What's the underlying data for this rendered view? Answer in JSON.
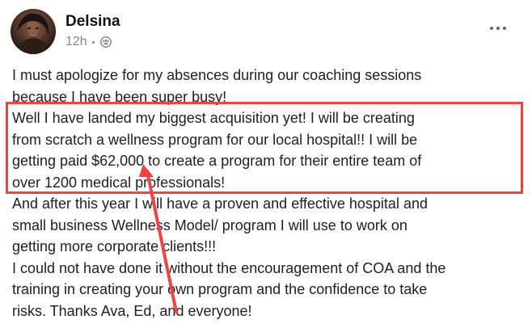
{
  "post": {
    "author": "Delsina",
    "time": "12h",
    "body_lines": [
      "I must apologize for my absences during our coaching sessions",
      "because I have been super busy!",
      "Well I have landed my biggest acquisition yet!  I will be creating",
      "from scratch a wellness program for our local hospital!!  I will be",
      "getting paid $62,000 to create a program for their entire team of",
      "over 1200 medical professionals!",
      " And after this year I will have a proven and effective hospital and",
      "small business Wellness Model/ program I will use to work on",
      "getting more corporate clients!!!",
      "I could not have done it without the encouragement of COA and the",
      "training in creating your own program and the confidence to take",
      "risks.  Thanks Ava, Ed, and everyone!"
    ]
  },
  "icons": {
    "avatar": "avatar",
    "privacy": "group-icon",
    "more": "more-options-icon",
    "arrow": "red-arrow"
  },
  "colors": {
    "highlight": "#ef4444",
    "text": "#1f1f1f",
    "meta": "#7f8791"
  }
}
